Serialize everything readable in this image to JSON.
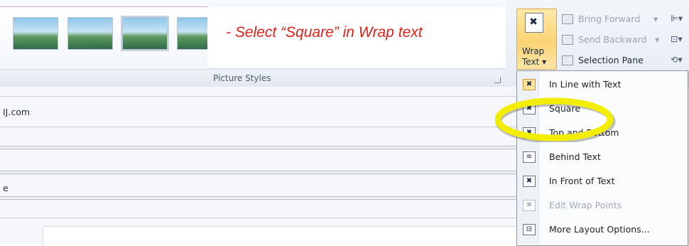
{
  "annotation": "- Select “Square” in Wrap text",
  "picture_styles": {
    "group_label": "Picture Styles",
    "thumb_count": 4
  },
  "arrange": {
    "bring_forward": "Bring Forward",
    "send_backward": "Send Backward",
    "selection_pane": "Selection Pane",
    "wrap_text": {
      "line1": "Wrap",
      "line2": "Text ▾"
    }
  },
  "fields": [
    {
      "text": "IJ.com"
    },
    {
      "text": ""
    },
    {
      "text": "e"
    },
    {
      "text": ""
    }
  ],
  "wrap_menu": {
    "items": [
      {
        "label": "In Line with Text",
        "state": "checked"
      },
      {
        "label": "Square",
        "state": "normal"
      },
      {
        "label": "Top and Bottom",
        "state": "normal"
      },
      {
        "label": "Behind Text",
        "state": "normal"
      },
      {
        "label": "In Front of Text",
        "state": "normal"
      },
      {
        "label": "Edit Wrap Points",
        "state": "disabled"
      },
      {
        "label": "More Layout Options...",
        "state": "normal"
      }
    ]
  },
  "colors": {
    "annotation": "#e0201a",
    "highlight": "#f3ee00",
    "selected_button": "#fbd374"
  }
}
